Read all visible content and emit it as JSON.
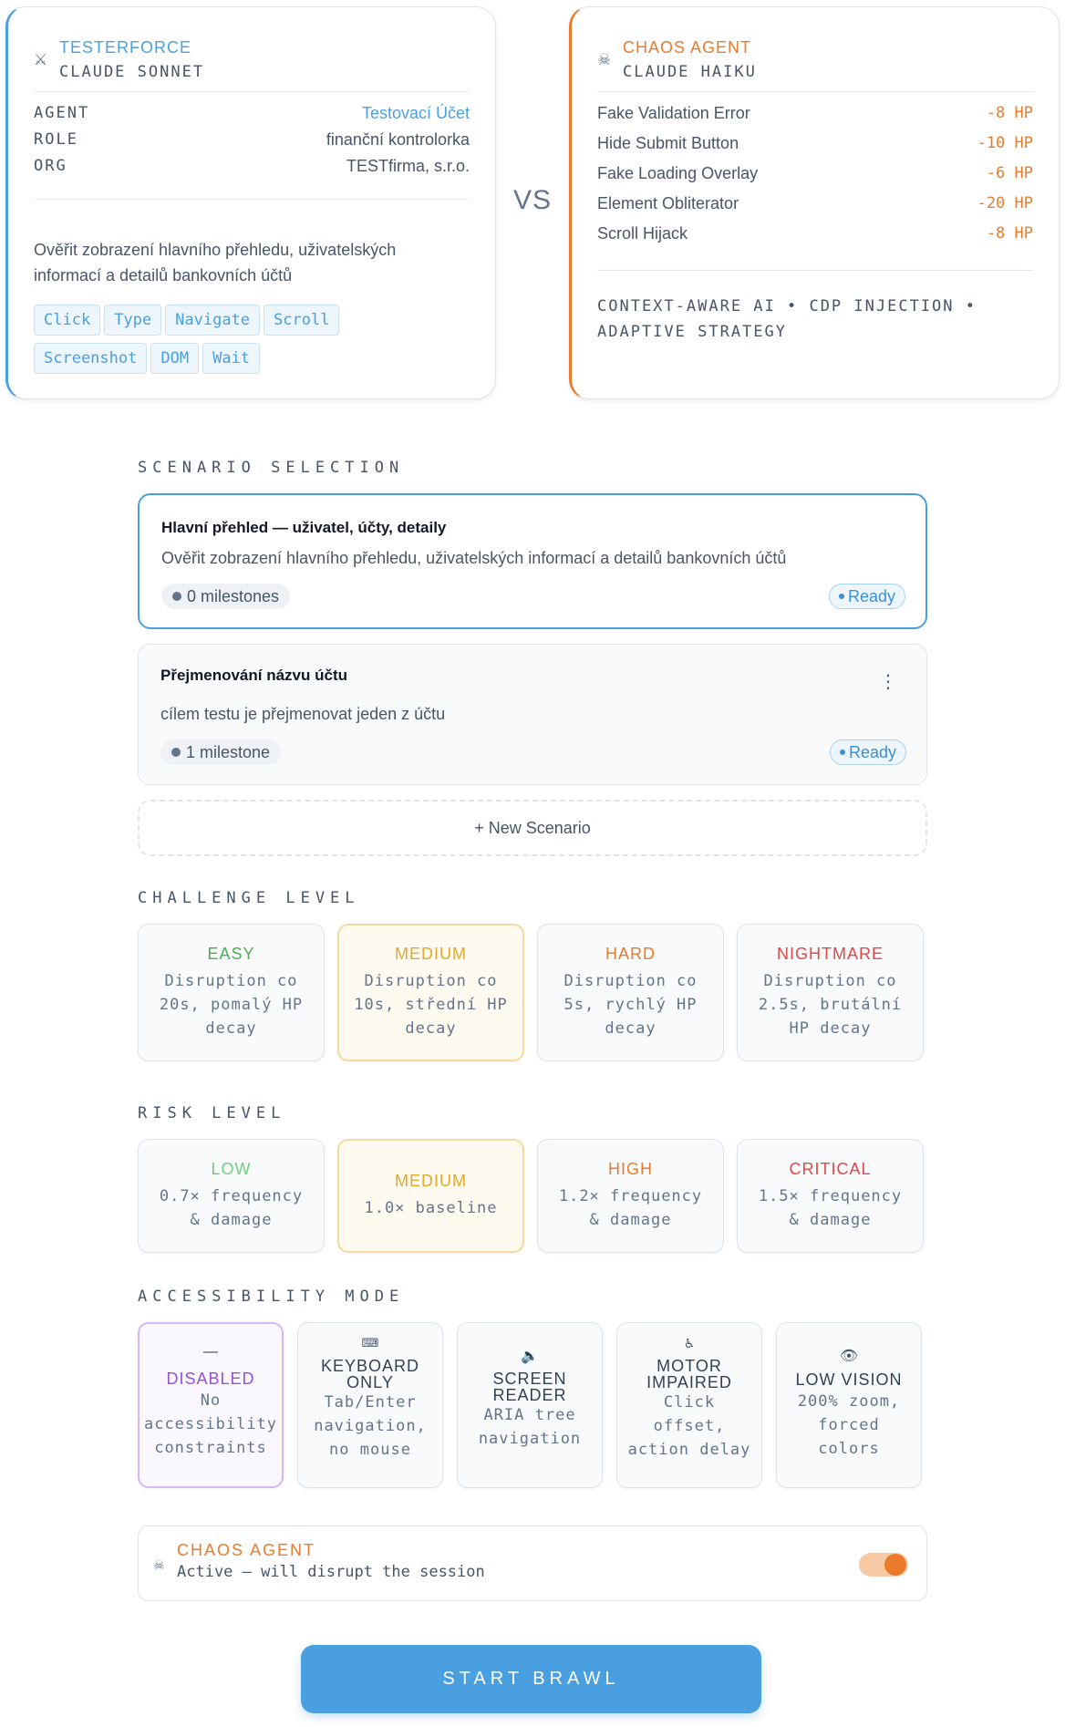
{
  "testerforce": {
    "title": "TESTERFORCE",
    "model": "CLAUDE SONNET",
    "icon": "swords-icon",
    "accent": "#4a9fe0",
    "info": [
      {
        "key": "AGENT",
        "value": "Testovací Účet"
      },
      {
        "key": "ROLE",
        "value": "finanční kontrolorka"
      },
      {
        "key": "ORG",
        "value": "TESTfirma, s.r.o."
      }
    ],
    "description": "Ověřit zobrazení hlavního přehledu, uživatelských informací a detailů bankovních účtů",
    "tools": [
      "Click",
      "Type",
      "Navigate",
      "Scroll",
      "Screenshot",
      "DOM",
      "Wait"
    ]
  },
  "vs": "VS",
  "chaos_agent": {
    "title": "CHAOS AGENT",
    "model": "CLAUDE HAIKU",
    "icon": "skull-icon",
    "accent": "#ea7b2c",
    "attacks": [
      {
        "name": "Fake Validation Error",
        "hp": "-8 HP"
      },
      {
        "name": "Hide Submit Button",
        "hp": "-10 HP"
      },
      {
        "name": "Fake Loading Overlay",
        "hp": "-6 HP"
      },
      {
        "name": "Element Obliterator",
        "hp": "-20 HP"
      },
      {
        "name": "Scroll Hijack",
        "hp": "-8 HP"
      }
    ],
    "features": "CONTEXT-AWARE AI • CDP INJECTION • ADAPTIVE STRATEGY"
  },
  "scenario_selection": {
    "label": "SCENARIO SELECTION",
    "scenarios": [
      {
        "title": "Hlavní přehled — uživatel, účty, detaily",
        "description": "Ověřit zobrazení hlavního přehledu, uživatelských informací a detailů bankovních účtů",
        "milestones": "0 milestones",
        "status": "Ready",
        "selected": true
      },
      {
        "title": "Přejmenování názvu účtu",
        "description": "cílem testu je přejmenovat jeden z účtu",
        "milestones": "1 milestone",
        "status": "Ready",
        "selected": false
      }
    ],
    "new_scenario": "+ New Scenario"
  },
  "challenge_level": {
    "label": "CHALLENGE LEVEL",
    "selected": "MEDIUM",
    "options": [
      {
        "title": "EASY",
        "desc_lines": [
          "Disruption co",
          "20s, pomalý HP",
          "decay"
        ],
        "color": "#4caf50"
      },
      {
        "title": "MEDIUM",
        "desc_lines": [
          "Disruption co",
          "10s, střední HP",
          "decay"
        ],
        "color": "#e0a82e"
      },
      {
        "title": "HARD",
        "desc_lines": [
          "Disruption co",
          "5s, rychlý HP",
          "decay"
        ],
        "color": "#ea7b2c"
      },
      {
        "title": "NIGHTMARE",
        "desc_lines": [
          "Disruption co",
          "2.5s, brutální",
          "HP decay"
        ],
        "color": "#e04848"
      }
    ]
  },
  "risk_level": {
    "label": "RISK LEVEL",
    "selected": "MEDIUM",
    "options": [
      {
        "title": "LOW",
        "desc_lines": [
          "0.7× frequency",
          "& damage"
        ],
        "color": "#6fcf7a"
      },
      {
        "title": "MEDIUM",
        "desc_lines": [
          "1.0× baseline"
        ],
        "color": "#e0a82e"
      },
      {
        "title": "HIGH",
        "desc_lines": [
          "1.2× frequency",
          "& damage"
        ],
        "color": "#ea7b2c"
      },
      {
        "title": "CRITICAL",
        "desc_lines": [
          "1.5× frequency",
          "& damage"
        ],
        "color": "#e04848"
      }
    ]
  },
  "accessibility_mode": {
    "label": "ACCESSIBILITY MODE",
    "selected": "DISABLED",
    "options": [
      {
        "icon": "dash-icon",
        "glyph": "—",
        "title_lines": [
          "DISABLED"
        ],
        "desc_lines": [
          "No",
          "accessibility",
          "constraints"
        ],
        "color": "#9b4fd6"
      },
      {
        "icon": "keyboard-icon",
        "glyph": "⌨",
        "title_lines": [
          "KEYBOARD",
          "ONLY"
        ],
        "desc_lines": [
          "Tab/Enter",
          "navigation,",
          "no mouse"
        ],
        "color": "#475569"
      },
      {
        "icon": "speaker-icon",
        "glyph": "🔈",
        "title_lines": [
          "SCREEN",
          "READER"
        ],
        "desc_lines": [
          "ARIA tree",
          "navigation"
        ],
        "color": "#475569"
      },
      {
        "icon": "wheelchair-icon",
        "glyph": "♿",
        "title_lines": [
          "MOTOR",
          "IMPAIRED"
        ],
        "desc_lines": [
          "Click",
          "offset,",
          "action delay"
        ],
        "color": "#475569"
      },
      {
        "icon": "eye-icon",
        "glyph": "👁",
        "title_lines": [
          "LOW VISION"
        ],
        "desc_lines": [
          "200% zoom,",
          "forced",
          "colors"
        ],
        "color": "#475569"
      }
    ]
  },
  "chaos_toggle": {
    "icon": "skull-icon",
    "title": "CHAOS AGENT",
    "status": "Active — will disrupt the session",
    "enabled": true
  },
  "start_button": "START BRAWL"
}
